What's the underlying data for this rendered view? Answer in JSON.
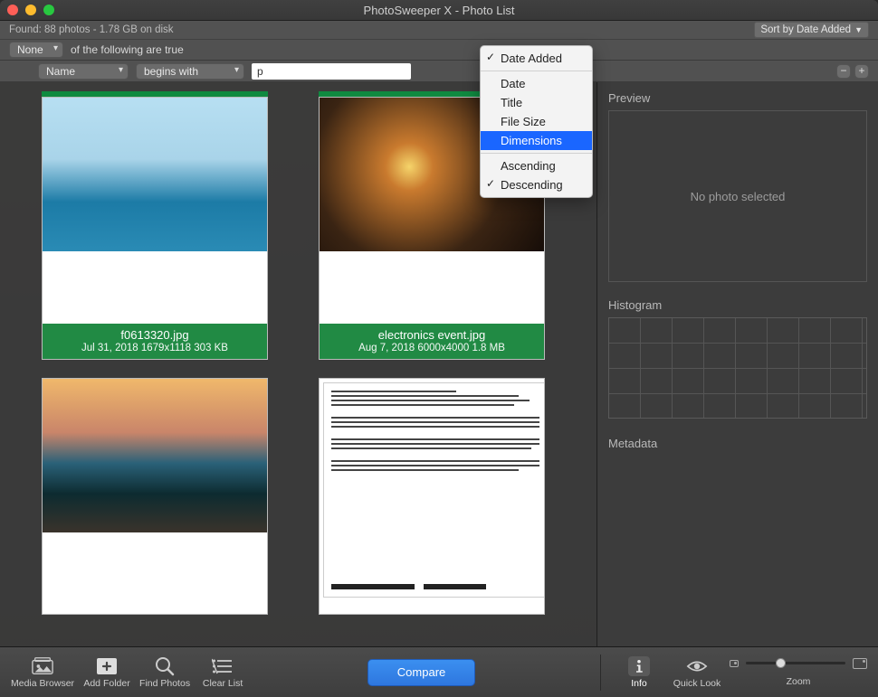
{
  "window": {
    "title": "PhotoSweeper X - Photo List"
  },
  "status": {
    "found": "Found: 88 photos - 1.78 GB on disk"
  },
  "sort_button": {
    "label": "Sort by Date Added"
  },
  "filter1": {
    "match": "None",
    "text": "of the following are true"
  },
  "filter2": {
    "attr": "Name",
    "op": "begins with",
    "value": "p"
  },
  "dropdown": {
    "items": [
      {
        "label": "Date Added",
        "checked": true
      },
      {
        "label": "Date"
      },
      {
        "label": "Title"
      },
      {
        "label": "File Size"
      },
      {
        "label": "Dimensions",
        "highlight": true
      }
    ],
    "order": [
      {
        "label": "Ascending"
      },
      {
        "label": "Descending",
        "checked": true
      }
    ]
  },
  "photos": [
    {
      "name": "f0613320.jpg",
      "meta": "Jul 31, 2018  1679x1118  303 KB"
    },
    {
      "name": "electronics event.jpg",
      "meta": "Aug 7, 2018  6000x4000  1.8 MB"
    }
  ],
  "sidebar": {
    "preview": "Preview",
    "no_selection": "No photo selected",
    "histogram": "Histogram",
    "metadata": "Metadata"
  },
  "toolbar": {
    "media_browser": "Media Browser",
    "add_folder": "Add Folder",
    "find_photos": "Find Photos",
    "clear_list": "Clear List",
    "compare": "Compare",
    "info": "Info",
    "quick_look": "Quick Look",
    "zoom": "Zoom"
  }
}
